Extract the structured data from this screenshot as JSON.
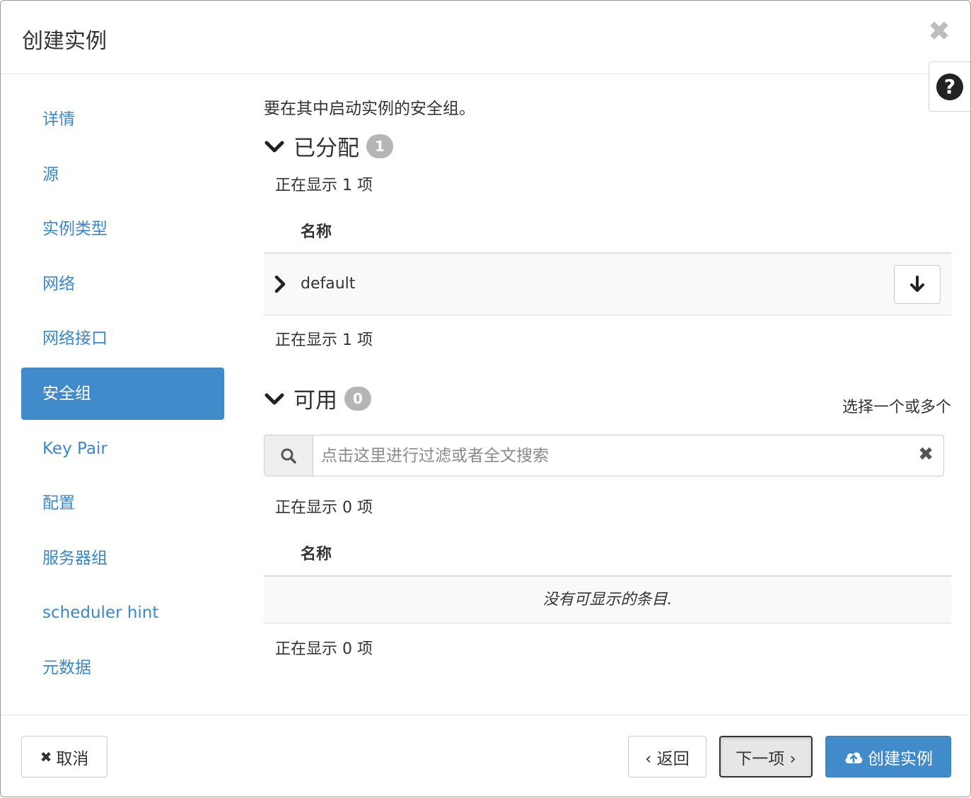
{
  "dialog": {
    "title": "创建实例",
    "close_glyph": "✖",
    "help_glyph": "?"
  },
  "sidebar": {
    "items": [
      {
        "label": "详情",
        "active": false
      },
      {
        "label": "源",
        "active": false
      },
      {
        "label": "实例类型",
        "active": false
      },
      {
        "label": "网络",
        "active": false
      },
      {
        "label": "网络接口",
        "active": false
      },
      {
        "label": "安全组",
        "active": true
      },
      {
        "label": "Key Pair",
        "active": false
      },
      {
        "label": "配置",
        "active": false
      },
      {
        "label": "服务器组",
        "active": false
      },
      {
        "label": "scheduler hint",
        "active": false
      },
      {
        "label": "元数据",
        "active": false
      }
    ]
  },
  "main": {
    "description": "要在其中启动实例的安全组。",
    "allocated": {
      "title": "已分配",
      "badge": "1",
      "count_top": "正在显示 1 项",
      "column_name": "名称",
      "rows": [
        {
          "name": "default"
        }
      ],
      "count_bottom": "正在显示 1 项"
    },
    "available": {
      "title": "可用",
      "badge": "0",
      "select_hint": "选择一个或多个",
      "search_placeholder": "点击这里进行过滤或者全文搜索",
      "search_value": "",
      "clear_glyph": "✖",
      "count_top": "正在显示 0 项",
      "column_name": "名称",
      "empty_text": "没有可显示的条目.",
      "count_bottom": "正在显示 0 项"
    }
  },
  "footer": {
    "cancel_glyph": "✖",
    "cancel_label": "取消",
    "back_label": "‹ 返回",
    "next_label": "下一项 ›",
    "create_label": "创建实例"
  },
  "colors": {
    "accent": "#428bca",
    "link": "#3a87c8",
    "badge": "#b5b5b5"
  },
  "icons": [
    "close-icon",
    "help-icon",
    "chevron-down-icon",
    "chevron-right-icon",
    "arrow-down-icon",
    "search-icon",
    "clear-icon",
    "cloud-upload-icon"
  ]
}
